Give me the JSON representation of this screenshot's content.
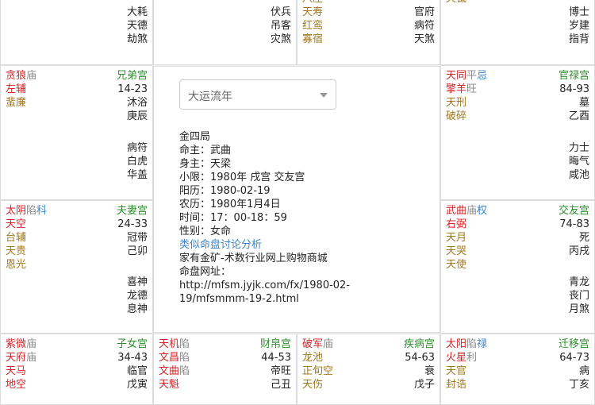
{
  "top": {
    "c1_right": [
      "大耗",
      "天德",
      "劫煞"
    ],
    "c2_right": [
      "伏兵",
      "吊客",
      "灾煞"
    ],
    "c3_left": [
      "八座",
      "天寿",
      "红鸾",
      "寡宿"
    ],
    "c3_right": [
      "官府",
      "病符",
      "天煞"
    ],
    "c4_left": [
      "天钺"
    ],
    "c4_right": [
      "博士",
      "岁建",
      "指背"
    ]
  },
  "left_mid1": {
    "stars": [
      [
        "贪狼",
        "庙"
      ],
      [
        "左辅",
        ""
      ],
      [
        "蜚廉",
        ""
      ]
    ],
    "palace": "兄弟宫",
    "range": "14-23",
    "stage": "沐浴",
    "stem": "庚辰",
    "gods": [
      "病符",
      "白虎",
      "华盖"
    ]
  },
  "left_mid2": {
    "stars": [
      [
        "太阴",
        "陷",
        "科"
      ],
      [
        "天空",
        ""
      ],
      [
        "台辅",
        ""
      ],
      [
        "天贵",
        ""
      ],
      [
        "恩光",
        ""
      ]
    ],
    "palace": "夫妻宫",
    "range": "24-33",
    "stage": "冠带",
    "stem": "己卯",
    "gods": [
      "喜神",
      "龙德",
      "息神"
    ]
  },
  "right_mid1": {
    "stars": [
      [
        "天同",
        "平",
        "忌"
      ],
      [
        "擎羊",
        "旺"
      ],
      [
        "天刑",
        ""
      ],
      [
        "破碎",
        ""
      ]
    ],
    "palace": "官禄宫",
    "range": "84-93",
    "stage": "墓",
    "stem": "乙酉",
    "gods": [
      "力士",
      "晦气",
      "咸池"
    ]
  },
  "right_mid2": {
    "stars": [
      [
        "武曲",
        "庙",
        "权"
      ],
      [
        "右弼",
        ""
      ],
      [
        "天月",
        ""
      ],
      [
        "天哭",
        ""
      ],
      [
        "天使",
        ""
      ]
    ],
    "palace": "交友宫",
    "range": "74-83",
    "stage": "死",
    "stem": "丙戌",
    "gods": [
      "青龙",
      "丧门",
      "月煞"
    ]
  },
  "bottom": [
    {
      "stars": [
        [
          "紫微",
          "庙"
        ],
        [
          "天府",
          "庙"
        ],
        [
          "天马",
          ""
        ],
        [
          "地空",
          ""
        ]
      ],
      "palace": "子女宫",
      "range": "34-43",
      "stage": "临官",
      "stem": "戊寅"
    },
    {
      "stars": [
        [
          "天机",
          "陷"
        ],
        [
          "文昌",
          "陷"
        ],
        [
          "文曲",
          "陷"
        ],
        [
          "天魁",
          ""
        ]
      ],
      "palace": "财帛宫",
      "range": "44-53",
      "stage": "帝旺",
      "stem": "己丑"
    },
    {
      "stars": [
        [
          "破军",
          "庙"
        ],
        [
          "龙池",
          ""
        ],
        [
          "正旬空",
          ""
        ],
        [
          "天伤",
          ""
        ]
      ],
      "palace": "疾病宫",
      "range": "54-63",
      "stage": "衰",
      "stem": "戊子"
    },
    {
      "stars": [
        [
          "太阳",
          "陷",
          "禄"
        ],
        [
          "火星",
          "利"
        ],
        [
          "天官",
          ""
        ],
        [
          "封诰",
          ""
        ]
      ],
      "palace": "迁移宫",
      "range": "64-73",
      "stage": "病",
      "stem": "丁亥"
    }
  ],
  "center": {
    "select_label": "大运流年",
    "lines": [
      "金四局",
      "命主：武曲",
      "身主：天梁",
      "小限：1980年 戌宫 交友宫",
      "阳历：1980-02-19",
      "农历：1980年1月4日",
      "时间：17：00-18：59",
      "性别：女命"
    ],
    "link": "类似命盘讨论分析",
    "footer": [
      "家有金矿-术数行业网上购物商城",
      "命盘网址：",
      "http://mfsm.jyjk.com/fx/1980-02-",
      "19/mfsmmm-19-2.html"
    ]
  },
  "colors": {
    "red": "#d0262a",
    "blue": "#3a84c8",
    "gold": "#a07820",
    "green": "#2f8e2f"
  }
}
